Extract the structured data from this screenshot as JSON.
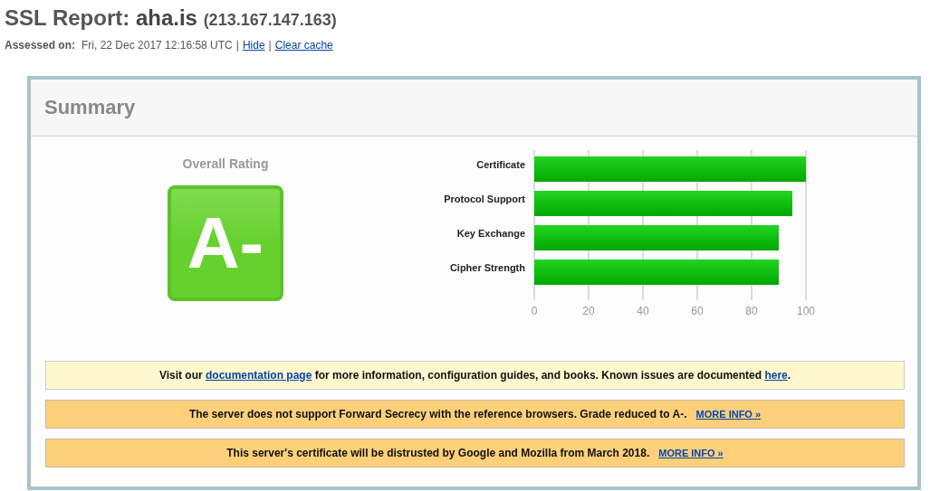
{
  "title": {
    "prefix": "SSL Report: ",
    "host": "aha.is",
    "ip": "(213.167.147.163)"
  },
  "assessed": {
    "label": "Assessed on:",
    "date": "Fri, 22 Dec 2017 12:16:58 UTC",
    "separator": "|",
    "links": [
      "Hide",
      "Clear cache"
    ]
  },
  "summary": {
    "heading": "Summary",
    "rating_label": "Overall Rating",
    "grade": "A-",
    "chart_data": {
      "type": "bar",
      "orientation": "horizontal",
      "categories": [
        "Certificate",
        "Protocol Support",
        "Key Exchange",
        "Cipher Strength"
      ],
      "values": [
        100,
        95,
        90,
        90
      ],
      "xlim": [
        0,
        100
      ],
      "xticks": [
        0,
        20,
        40,
        60,
        80,
        100
      ],
      "grid": true
    },
    "notices": [
      {
        "kind": "info",
        "parts": [
          {
            "text": "Visit our "
          },
          {
            "link": "documentation page"
          },
          {
            "text": " for more information, configuration guides, and books. Known issues are documented "
          },
          {
            "link": "here"
          },
          {
            "text": "."
          }
        ]
      },
      {
        "kind": "warning",
        "text": "The server does not support Forward Secrecy with the reference browsers. Grade reduced to A-.",
        "more": "MORE INFO »"
      },
      {
        "kind": "warning",
        "text": "This server's certificate will be distrusted by Google and Mozilla from March 2018.",
        "more": "MORE INFO »"
      }
    ]
  }
}
